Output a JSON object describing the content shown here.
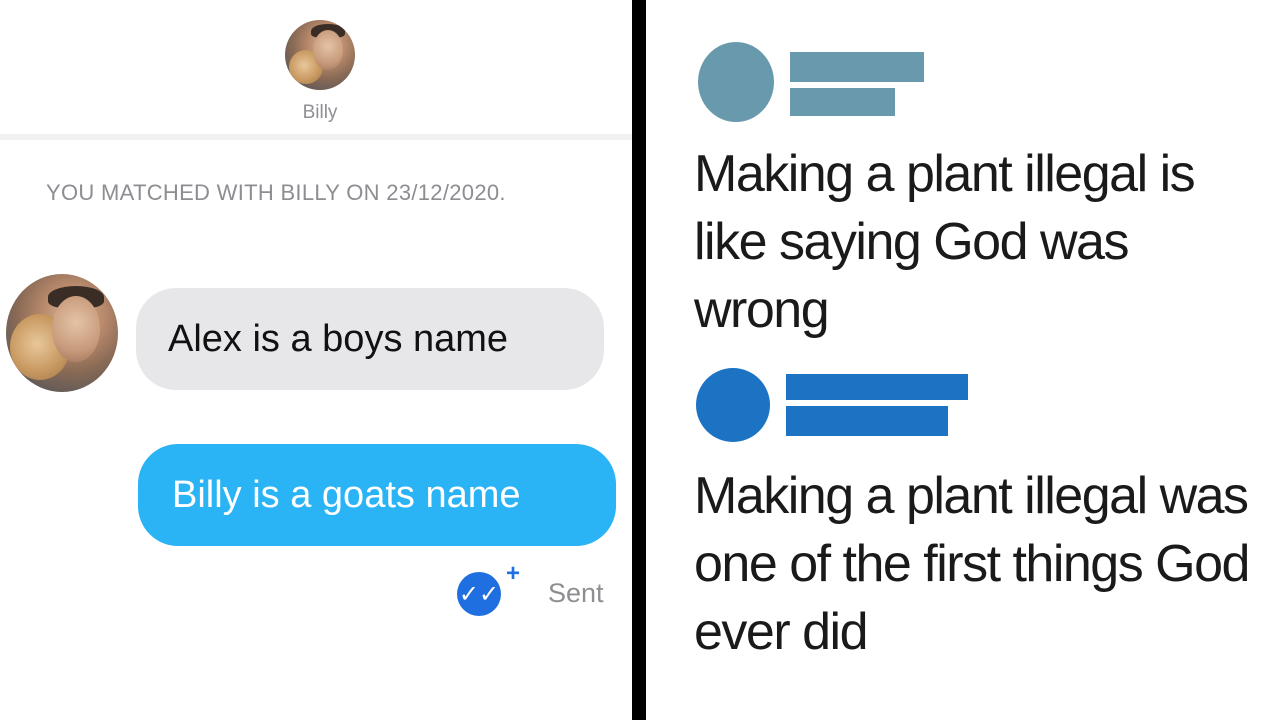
{
  "chat": {
    "contact_name": "Billy",
    "match_notice": "YOU MATCHED WITH BILLY ON 23/12/2020.",
    "received_message": "Alex is a boys name",
    "sent_message": "Billy is a goats name",
    "receipt_glyph": "✓✓",
    "plus_glyph": "+",
    "sent_status": "Sent",
    "colors": {
      "received_bubble": "#e7e7ea",
      "sent_bubble": "#2ab3f5",
      "receipt": "#1f6fe0"
    }
  },
  "tweets": [
    {
      "text": "Making a plant illegal is like saying God was wrong",
      "color": "#6899ad"
    },
    {
      "text": "Making a plant illegal was one of the first things God ever did",
      "color": "#1c73c4"
    }
  ]
}
